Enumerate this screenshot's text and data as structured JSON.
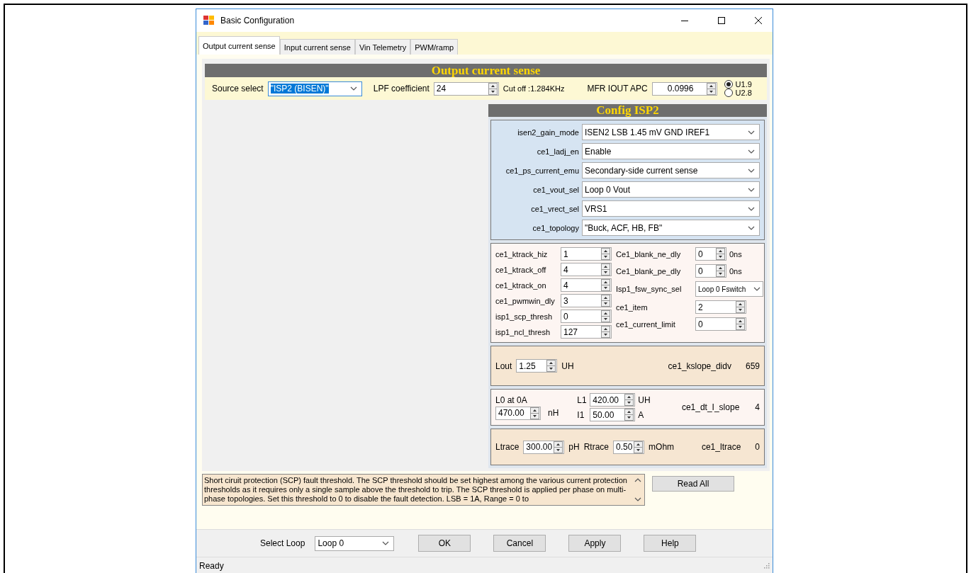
{
  "window": {
    "title": "Basic Configuration"
  },
  "tabs": [
    {
      "label": "Output current sense",
      "selected": true
    },
    {
      "label": "Input current sense",
      "selected": false
    },
    {
      "label": "Vin Telemetry",
      "selected": false
    },
    {
      "label": "PWM/ramp",
      "selected": false
    }
  ],
  "output_section": {
    "header": "Output current sense",
    "source_label": "Source select",
    "source_value": "\"ISP2 (BISEN)\"",
    "lpf_label": "LPF coefficient",
    "lpf_value": "24",
    "cutoff": "Cut off :1.284KHz",
    "mfr_label": "MFR IOUT APC",
    "mfr_value": "0.0996",
    "radios": [
      {
        "label": "U1.9",
        "selected": true
      },
      {
        "label": "U2.8",
        "selected": false
      }
    ]
  },
  "config": {
    "header": "Config ISP2",
    "dropdown_fields": [
      {
        "label": "isen2_gain_mode",
        "value": "ISEN2 LSB 1.45 mV GND IREF1"
      },
      {
        "label": "ce1_ladj_en",
        "value": "Enable"
      },
      {
        "label": "ce1_ps_current_emu",
        "value": "Secondary-side current sense"
      },
      {
        "label": "ce1_vout_sel",
        "value": "Loop 0 Vout"
      },
      {
        "label": "ce1_vrect_sel",
        "value": "VRS1"
      },
      {
        "label": "ce1_topology",
        "value": "\"Buck, ACF, HB, FB\""
      }
    ],
    "left_spins": [
      {
        "label": "ce1_ktrack_hiz",
        "value": "1"
      },
      {
        "label": "ce1_ktrack_off",
        "value": "4"
      },
      {
        "label": "ce1_ktrack_on",
        "value": "4"
      },
      {
        "label": "ce1_pwmwin_dly",
        "value": "3"
      },
      {
        "label": "isp1_scp_thresh",
        "value": "0"
      },
      {
        "label": "isp1_ncl_thresh",
        "value": "127"
      }
    ],
    "right_fields": [
      {
        "kind": "spin-unit",
        "label": "Ce1_blank_ne_dly",
        "value": "0",
        "unit": "0ns"
      },
      {
        "kind": "spin-unit",
        "label": "Ce1_blank_pe_dly",
        "value": "0",
        "unit": "0ns"
      },
      {
        "kind": "dropdown",
        "label": "Isp1_fsw_sync_sel",
        "value": "Loop 0 Fswitch"
      },
      {
        "kind": "spin",
        "label": "ce1_item",
        "value": "2"
      },
      {
        "kind": "spin",
        "label": "ce1_current_limit",
        "value": "0"
      }
    ],
    "lout": {
      "label": "Lout",
      "value": "1.25",
      "unit": "UH",
      "result_label": "ce1_kslope_didv",
      "result": "659"
    },
    "inductance": {
      "l0_label": "L0 at 0A",
      "l0_value": "470.00",
      "l0_unit": "nH",
      "l1_label": "L1",
      "l1_value": "420.00",
      "l1_unit": "UH",
      "i1_label": "I1",
      "i1_value": "50.00",
      "i1_unit": "A",
      "result_label": "ce1_dt_I_slope",
      "result": "4"
    },
    "trace": {
      "ltrace_label": "Ltrace",
      "ltrace_value": "300.00",
      "ltrace_unit": "pH",
      "rtrace_label": "Rtrace",
      "rtrace_value": "0.50",
      "rtrace_unit": "mOhm",
      "result_label": "ce1_ltrace",
      "result": "0"
    }
  },
  "description": "Short ciruit protection (SCP) fault threshold.  The SCP threshold should be set highest among the various current protection thresholds as it requires only a single sample above the threshold to trip. The SCP threshold is applied per phase on multi-phase topologies.  Set this threshold to 0 to disable the fault detection. LSB = 1A, Range = 0 to",
  "read_all": "Read All",
  "select_loop": {
    "label": "Select Loop",
    "value": "Loop 0"
  },
  "buttons": [
    "OK",
    "Cancel",
    "Apply",
    "Help"
  ],
  "status_bar": "Ready"
}
